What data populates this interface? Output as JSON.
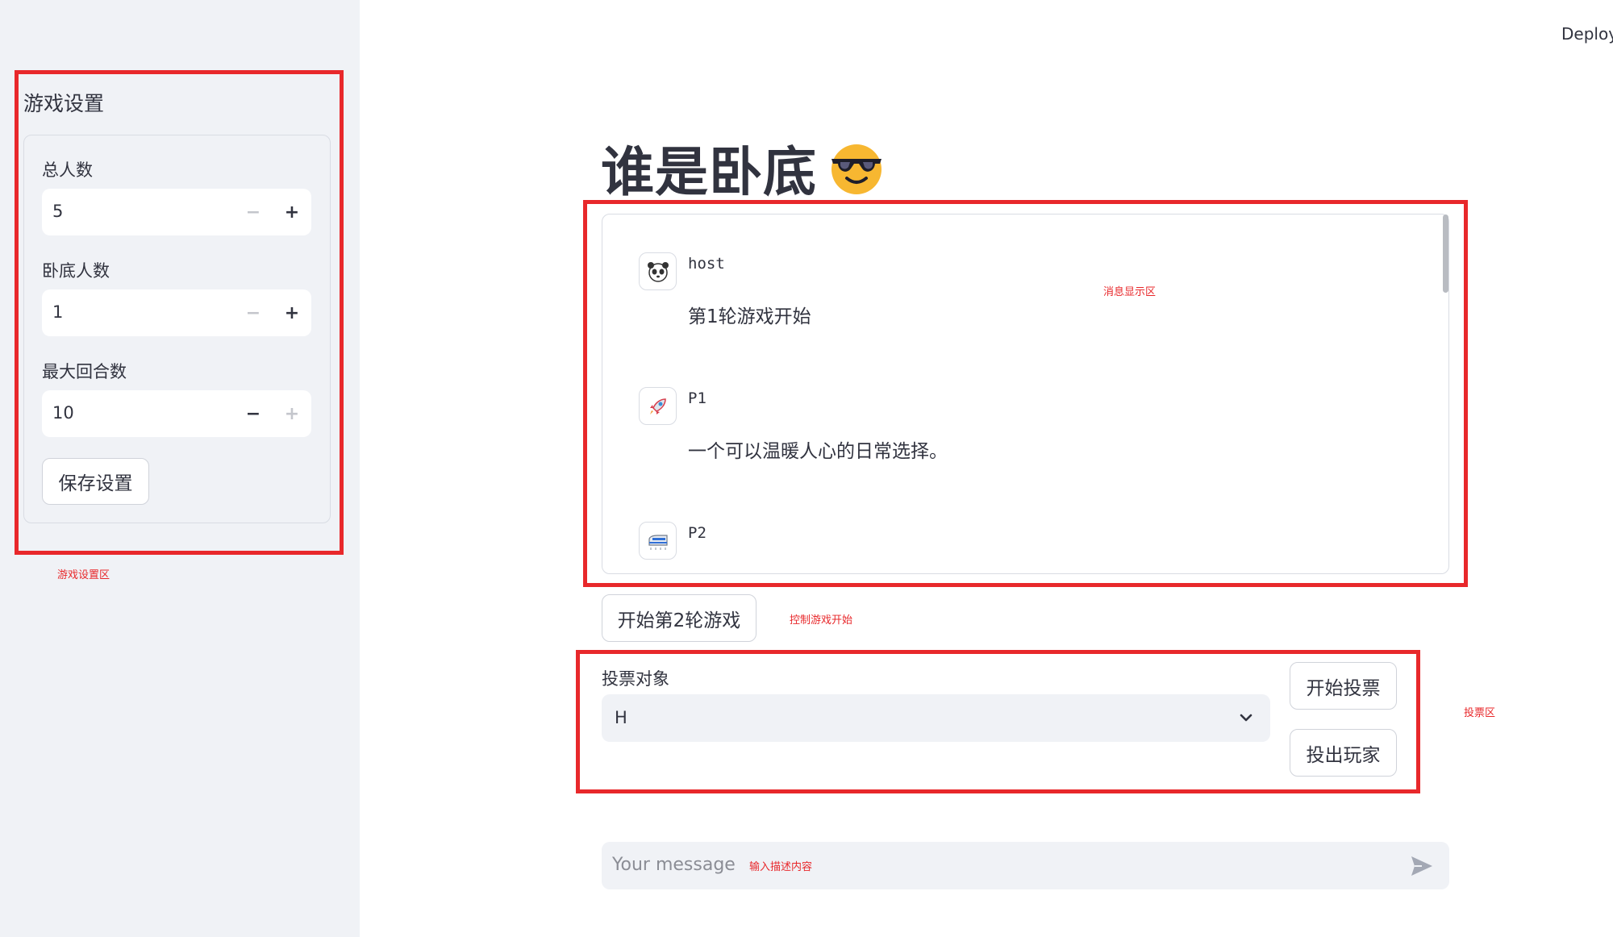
{
  "sidebar": {
    "title": "游戏设置",
    "fields": [
      {
        "label": "总人数",
        "value": "5",
        "minus_disabled": true,
        "plus_disabled": false
      },
      {
        "label": "卧底人数",
        "value": "1",
        "minus_disabled": true,
        "plus_disabled": false
      },
      {
        "label": "最大回合数",
        "value": "10",
        "minus_disabled": false,
        "plus_disabled": true
      }
    ],
    "save_label": "保存设置"
  },
  "header": {
    "deploy_label": "Deploy"
  },
  "main": {
    "title": "谁是卧底",
    "title_emoji": "smiling-face-with-sunglasses-icon",
    "messages": [
      {
        "sender": "host",
        "avatar_icon": "panda-icon",
        "text": "第1轮游戏开始"
      },
      {
        "sender": "P1",
        "avatar_icon": "rocket-icon",
        "text": "一个可以温暖人心的日常选择。"
      },
      {
        "sender": "P2",
        "avatar_icon": "train-icon",
        "text": ""
      }
    ],
    "start_round_label": "开始第2轮游戏",
    "vote": {
      "label": "投票对象",
      "selected": "H",
      "start_vote_label": "开始投票",
      "eliminate_label": "投出玩家"
    },
    "chat_input": {
      "placeholder": "Your message"
    }
  },
  "annotations": {
    "settings_area": "游戏设置区",
    "message_area": "消息显示区",
    "game_control": "控制游戏开始",
    "vote_area": "投票区",
    "input_hint": "输入描述内容"
  },
  "colors": {
    "annotation_red": "#e8282b",
    "sidebar_bg": "#f0f2f6",
    "text": "#31333f"
  }
}
